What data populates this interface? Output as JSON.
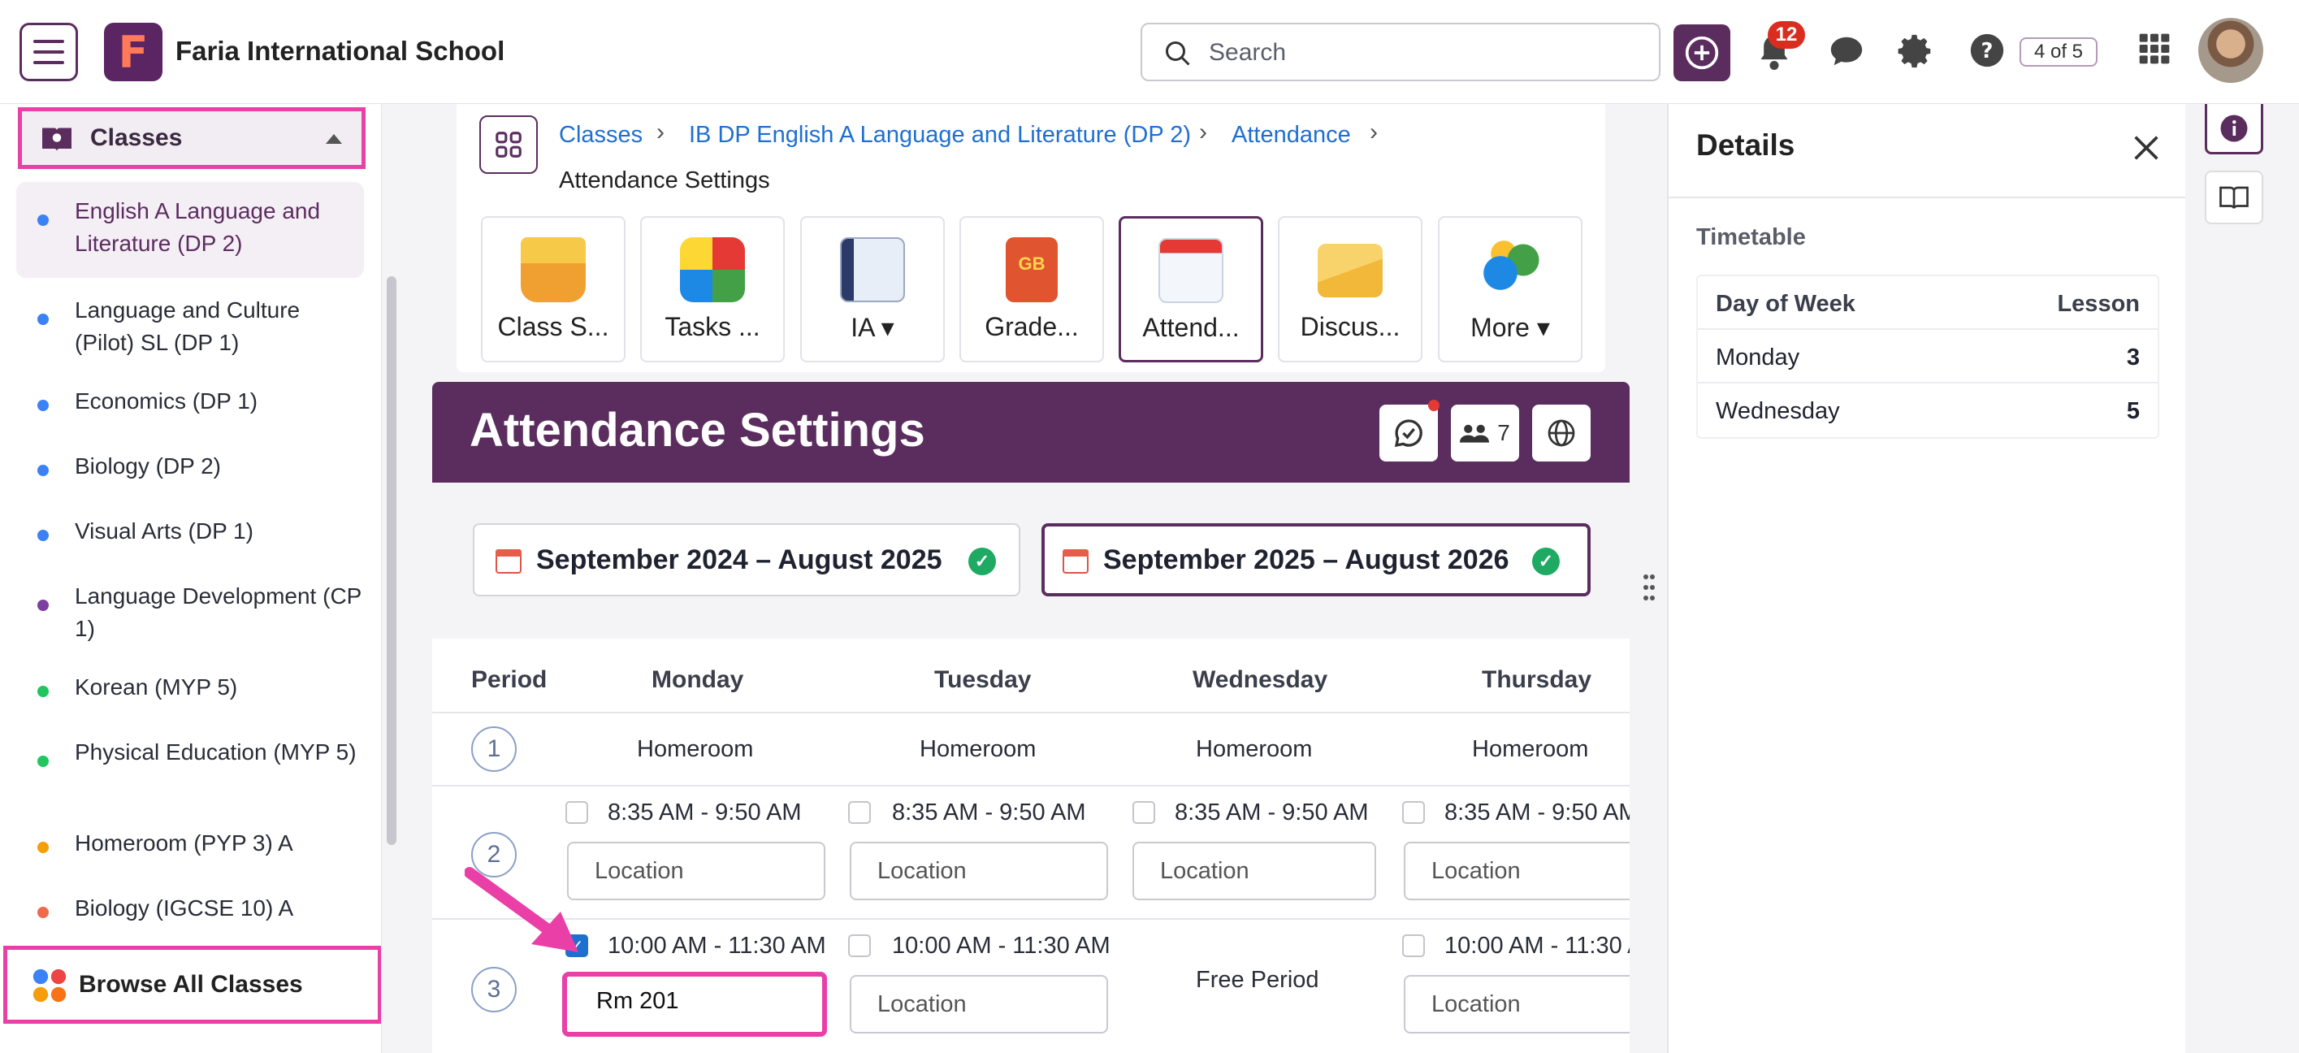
{
  "topbar": {
    "logo_letter": "F",
    "school_name": "Faria International School",
    "search_placeholder": "Search",
    "notification_count": "12",
    "counter": "4 of 5"
  },
  "sidebar": {
    "section_label": "Classes",
    "items": [
      {
        "label": "English A Language and Literature (DP 2)",
        "dot": "#3b82f6"
      },
      {
        "label": "Language and Culture (Pilot) SL (DP 1)",
        "dot": "#3b82f6"
      },
      {
        "label": "Economics (DP 1)",
        "dot": "#3b82f6"
      },
      {
        "label": "Biology (DP 2)",
        "dot": "#3b82f6"
      },
      {
        "label": "Visual Arts (DP 1)",
        "dot": "#3b82f6"
      },
      {
        "label": "Language Development (CP 1)",
        "dot": "#7b3fa0"
      },
      {
        "label": "Korean (MYP 5)",
        "dot": "#22c55e"
      },
      {
        "label": "Physical Education (MYP 5)",
        "dot": "#22c55e"
      },
      {
        "label": "Homeroom (PYP 3) A",
        "dot": "#f59e0b"
      },
      {
        "label": "Biology (IGCSE 10) A",
        "dot": "#ef6a4a"
      }
    ],
    "browse_label": "Browse All Classes"
  },
  "breadcrumb": {
    "items": [
      "Classes",
      "IB DP English A Language and Literature (DP 2)",
      "Attendance"
    ],
    "current": "Attendance Settings"
  },
  "tools": [
    {
      "label": "Class S...",
      "icon": "class-stream-icon"
    },
    {
      "label": "Tasks ...",
      "icon": "puzzle-icon"
    },
    {
      "label": "IA ▾",
      "icon": "ia-documents-icon"
    },
    {
      "label": "Grade...",
      "icon": "gradebook-icon"
    },
    {
      "label": "Attend...",
      "icon": "attendance-calendar-icon"
    },
    {
      "label": "Discus...",
      "icon": "envelope-icon"
    },
    {
      "label": "More ▾",
      "icon": "more-apps-icon"
    }
  ],
  "banner": {
    "title": "Attendance Settings",
    "member_count": "7"
  },
  "years": [
    {
      "label": "September 2024 – August 2025"
    },
    {
      "label": "September 2025 – August 2026"
    }
  ],
  "timetable": {
    "headers": {
      "period": "Period",
      "days": [
        "Monday",
        "Tuesday",
        "Wednesday",
        "Thursday"
      ]
    },
    "rows": [
      {
        "period": "1",
        "cells": [
          "Homeroom",
          "Homeroom",
          "Homeroom",
          "Homeroom"
        ]
      },
      {
        "period": "2",
        "time": "8:35 AM - 9:50 AM",
        "location_placeholder": "Location"
      },
      {
        "period": "3",
        "time": "10:00 AM - 11:30 AM",
        "monday_location": "Rm 201",
        "free": "Free Period",
        "location_placeholder": "Location"
      }
    ]
  },
  "details": {
    "title": "Details",
    "section": "Timetable",
    "columns": [
      "Day of Week",
      "Lesson"
    ],
    "rows": [
      {
        "day": "Monday",
        "lesson": "3"
      },
      {
        "day": "Wednesday",
        "lesson": "5"
      }
    ]
  },
  "colors": {
    "brand": "#5b2d5f",
    "highlight": "#e93fa6",
    "link": "#1f6fd0",
    "success": "#1eaa63"
  }
}
